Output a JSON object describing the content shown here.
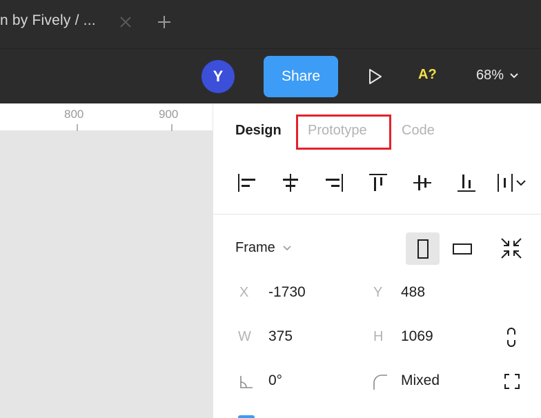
{
  "window": {
    "tab_title": "n by Fively / ...",
    "close_tab_icon": "close-icon",
    "new_tab_icon": "plus-icon"
  },
  "toolbar": {
    "avatar_initial": "Y",
    "share_label": "Share",
    "play_icon": "play-icon",
    "accessibility_label": "A?",
    "zoom_label": "68%"
  },
  "ruler": {
    "labels": [
      "800",
      "900"
    ]
  },
  "panel": {
    "tabs": [
      {
        "label": "Design",
        "active": true
      },
      {
        "label": "Prototype",
        "active": false,
        "highlighted": true
      },
      {
        "label": "Code",
        "active": false
      }
    ],
    "align_icons": [
      "align-left-icon",
      "align-horizontal-center-icon",
      "align-right-icon",
      "align-top-icon",
      "align-vertical-center-icon",
      "align-bottom-icon",
      "distribute-icon"
    ],
    "frame": {
      "label": "Frame",
      "orientation": "portrait"
    },
    "props": {
      "x_label": "X",
      "x_value": "-1730",
      "y_label": "Y",
      "y_value": "488",
      "w_label": "W",
      "w_value": "375",
      "h_label": "H",
      "h_value": "1069",
      "rotation_value": "0°",
      "radius_value": "Mixed"
    }
  },
  "colors": {
    "dark_bg": "#2c2c2c",
    "share_blue": "#3d9cf5",
    "avatar_blue": "#3b4fd8",
    "a11y_yellow": "#f5e04a",
    "highlight_red": "#e5202a"
  }
}
